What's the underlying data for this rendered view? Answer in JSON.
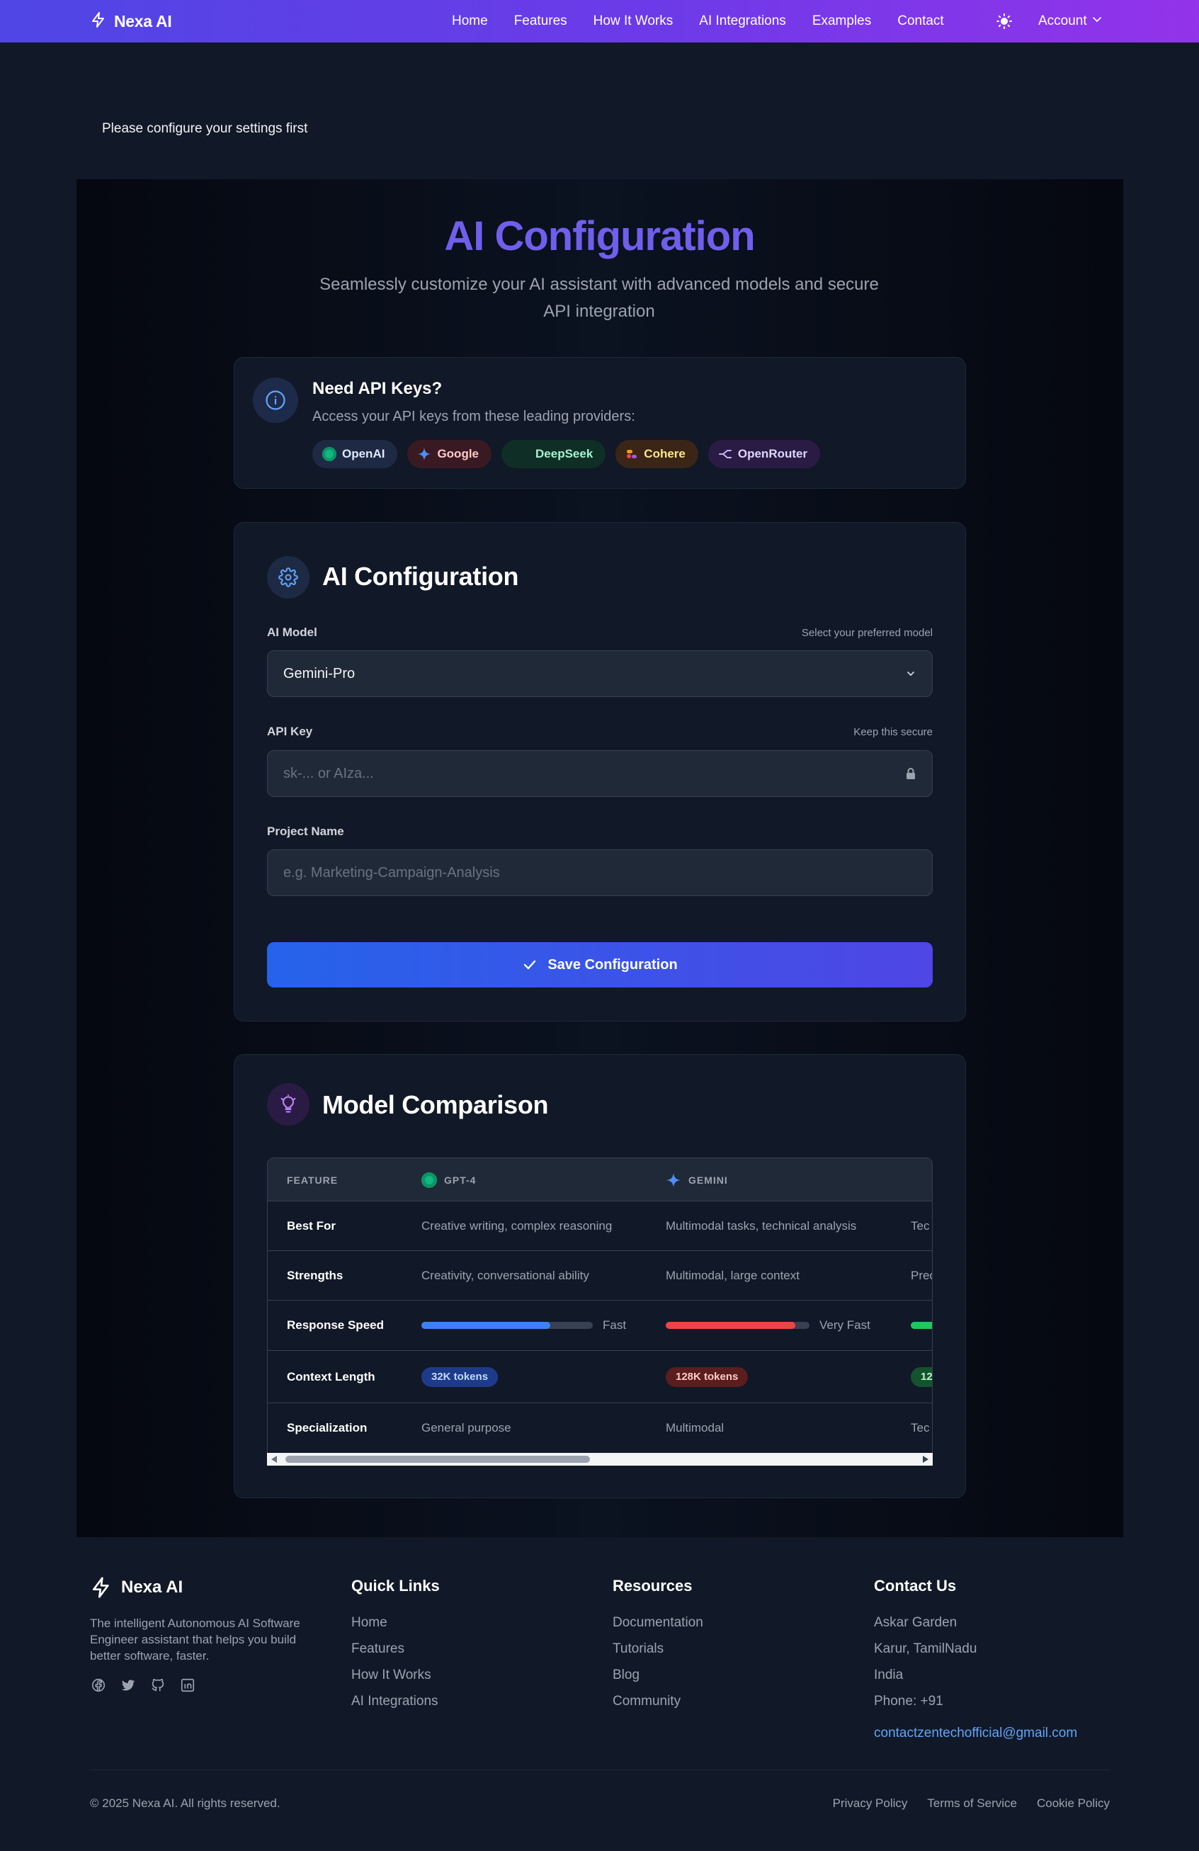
{
  "navbar": {
    "brand": "Nexa AI",
    "links": [
      "Home",
      "Features",
      "How It Works",
      "AI Integrations",
      "Examples",
      "Contact"
    ],
    "account_label": "Account",
    "gradient": [
      "#4f46e5",
      "#9333ea"
    ]
  },
  "alert": {
    "message": "Please configure your settings first"
  },
  "hero": {
    "title": "AI Configuration",
    "subtitle": "Seamlessly customize your AI assistant with advanced models and secure API integration"
  },
  "api_keys": {
    "title": "Need API Keys?",
    "description": "Access your API keys from these leading providers:",
    "providers": [
      {
        "name": "OpenAI",
        "icon": "openai-icon",
        "color": "#10b981"
      },
      {
        "name": "Google",
        "icon": "google-sparkle-icon",
        "color": "#3b82f6"
      },
      {
        "name": "DeepSeek",
        "icon": "",
        "color": "#34d399"
      },
      {
        "name": "Cohere",
        "icon": "cohere-icon",
        "color": "#f59e0b"
      },
      {
        "name": "OpenRouter",
        "icon": "openrouter-icon",
        "color": "#a78bfa"
      }
    ]
  },
  "config": {
    "title": "AI Configuration",
    "model_label": "AI Model",
    "model_hint": "Select your preferred model",
    "model_value": "Gemini-Pro",
    "api_key_label": "API Key",
    "api_key_hint": "Keep this secure",
    "api_key_placeholder": "sk-... or AIza...",
    "project_label": "Project Name",
    "project_placeholder": "e.g. Marketing-Campaign-Analysis",
    "save_label": "Save Configuration"
  },
  "comparison": {
    "title": "Model Comparison",
    "headers": [
      "FEATURE",
      "GPT-4",
      "GEMINI"
    ],
    "rows": {
      "best_for": {
        "label": "Best For",
        "gpt4": "Creative writing, complex reasoning",
        "gemini": "Multimodal tasks, technical analysis",
        "third": "Tec"
      },
      "strengths": {
        "label": "Strengths",
        "gpt4": "Creativity, conversational ability",
        "gemini": "Multimodal, large context",
        "third": "Pred"
      },
      "speed": {
        "label": "Response Speed",
        "gpt4": "Fast",
        "gpt4_level": 0.75,
        "gemini": "Very Fast",
        "gemini_level": 0.9,
        "third_level": 1.0
      },
      "context": {
        "label": "Context Length",
        "gpt4": "32K tokens",
        "gemini": "128K tokens",
        "third": "12"
      },
      "specialization": {
        "label": "Specialization",
        "gpt4": "General purpose",
        "gemini": "Multimodal",
        "third": "Tec"
      }
    },
    "colors": {
      "gpt4": "#3b82f6",
      "gemini": "#ef4444",
      "third": "#22c55e"
    }
  },
  "footer": {
    "brand": "Nexa AI",
    "about": "The intelligent Autonomous AI Software Engineer assistant that helps you build better software, faster.",
    "quick_links": {
      "title": "Quick Links",
      "items": [
        "Home",
        "Features",
        "How It Works",
        "AI Integrations"
      ]
    },
    "resources": {
      "title": "Resources",
      "items": [
        "Documentation",
        "Tutorials",
        "Blog",
        "Community"
      ]
    },
    "contact": {
      "title": "Contact Us",
      "lines": [
        "Askar Garden",
        "Karur, TamilNadu",
        "India",
        "Phone: +91"
      ],
      "email": "contactzentechofficial@gmail.com"
    },
    "copyright": "© 2025 Nexa AI. All rights reserved.",
    "legal": [
      "Privacy Policy",
      "Terms of Service",
      "Cookie Policy"
    ]
  }
}
